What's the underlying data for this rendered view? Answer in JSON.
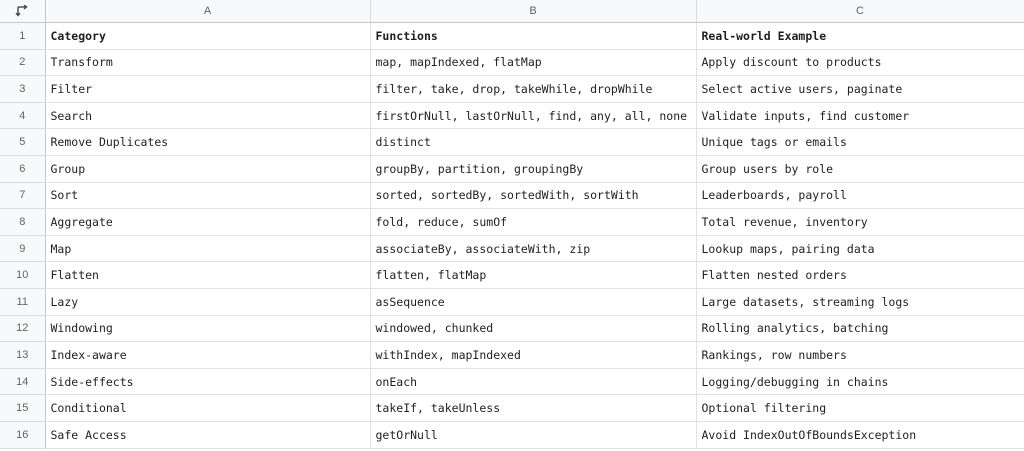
{
  "columns": [
    "A",
    "B",
    "C"
  ],
  "rows": [
    {
      "n": "1",
      "a": "Category",
      "b": "Functions",
      "c": "Real-world Example"
    },
    {
      "n": "2",
      "a": "Transform",
      "b": "map, mapIndexed, flatMap",
      "c": "Apply discount to products"
    },
    {
      "n": "3",
      "a": "Filter",
      "b": "filter, take, drop, takeWhile, dropWhile",
      "c": "Select active users, paginate"
    },
    {
      "n": "4",
      "a": "Search",
      "b": "firstOrNull, lastOrNull, find, any, all, none",
      "c": "Validate inputs, find customer"
    },
    {
      "n": "5",
      "a": "Remove Duplicates",
      "b": "distinct",
      "c": "Unique tags or emails"
    },
    {
      "n": "6",
      "a": "Group",
      "b": "groupBy, partition, groupingBy",
      "c": "Group users by role"
    },
    {
      "n": "7",
      "a": "Sort",
      "b": "sorted, sortedBy, sortedWith, sortWith",
      "c": "Leaderboards, payroll"
    },
    {
      "n": "8",
      "a": "Aggregate",
      "b": "fold, reduce, sumOf",
      "c": "Total revenue, inventory"
    },
    {
      "n": "9",
      "a": "Map",
      "b": "associateBy, associateWith, zip",
      "c": "Lookup maps, pairing data"
    },
    {
      "n": "10",
      "a": "Flatten",
      "b": "flatten, flatMap",
      "c": "Flatten nested orders"
    },
    {
      "n": "11",
      "a": "Lazy",
      "b": "asSequence",
      "c": "Large datasets, streaming logs"
    },
    {
      "n": "12",
      "a": "Windowing",
      "b": "windowed, chunked",
      "c": "Rolling analytics, batching"
    },
    {
      "n": "13",
      "a": "Index-aware",
      "b": "withIndex, mapIndexed",
      "c": "Rankings, row numbers"
    },
    {
      "n": "14",
      "a": "Side-effects",
      "b": "onEach",
      "c": "Logging/debugging in chains"
    },
    {
      "n": "15",
      "a": "Conditional",
      "b": "takeIf, takeUnless",
      "c": "Optional filtering"
    },
    {
      "n": "16",
      "a": "Safe Access",
      "b": "getOrNull",
      "c": "Avoid IndexOutOfBoundsException"
    }
  ],
  "icons": {
    "corner": "swap-arrows-icon"
  },
  "colors": {
    "header_bg": "#f8f9fa",
    "grid_line": "#e1e3e1",
    "text": "#1f1f1f",
    "header_text": "#5f6368"
  }
}
